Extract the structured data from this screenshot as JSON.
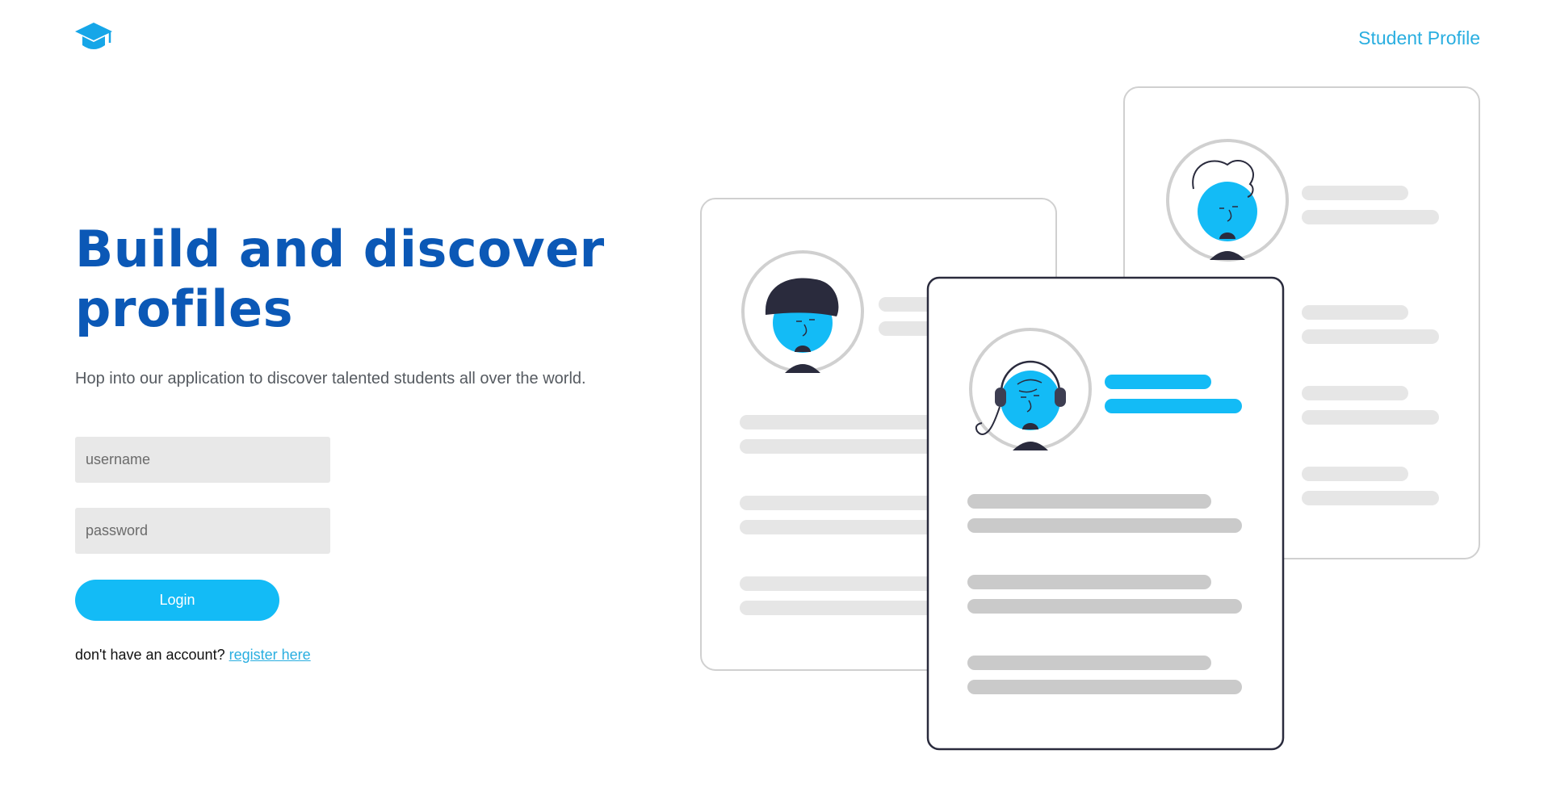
{
  "header": {
    "logo_icon": "graduation-cap-icon",
    "nav_link": "Student Profile"
  },
  "hero": {
    "headline_line1": "Build and discover",
    "headline_line2": "profiles",
    "subtext": "Hop into our application to discover talented students all over the world."
  },
  "form": {
    "username_placeholder": "username",
    "password_placeholder": "password",
    "login_label": "Login",
    "register_prompt": "don't have an account?",
    "register_link": "register here"
  },
  "illustration": {
    "icons": [
      "profile-card-cap-avatar-icon",
      "profile-card-headset-avatar-icon",
      "profile-card-curly-hair-avatar-icon"
    ]
  },
  "colors": {
    "brand_blue": "#0b58b6",
    "accent_cyan": "#13bbf6",
    "link_blue": "#29aee0",
    "input_bg": "#e8e8e8",
    "dark_navy": "#2a2b3d"
  }
}
